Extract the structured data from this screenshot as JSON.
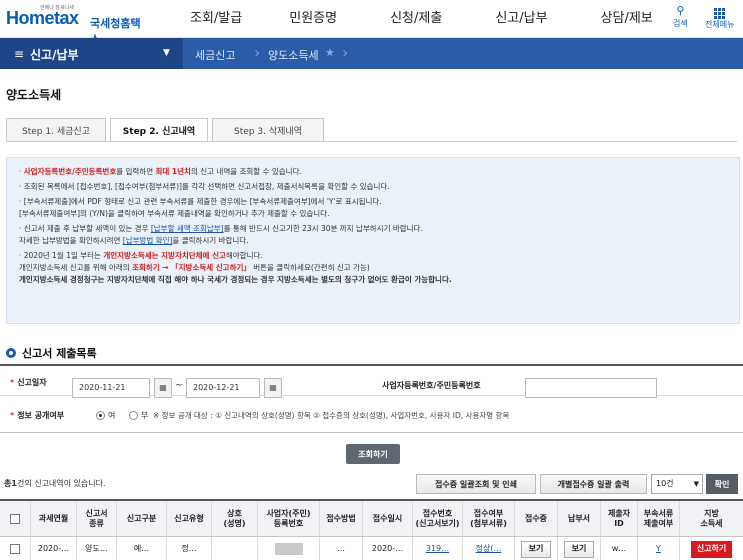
{
  "header": {
    "logo_text": "Hometax",
    "logo_tagline": "언제나 잘세나세",
    "logo_sub": "국세청홈택스",
    "menu": [
      "조회/발급",
      "민원증명",
      "신청/제출",
      "신고/납부",
      "상담/제보"
    ],
    "search_label": "검색",
    "all_menu_label": "전체메뉴"
  },
  "nav": {
    "section": "신고/납부",
    "crumb1": "세금신고",
    "crumb2": "양도소득세"
  },
  "page": {
    "title": "양도소득세"
  },
  "tabs": [
    "Step 1. 세금신고",
    "Step 2. 신고내역",
    "Step 3. 삭제내역"
  ],
  "notice": {
    "l1a": "·",
    "l1b": "사업자등록번호/주민등록번호",
    "l1c": "를 입력하면 ",
    "l1d": "최대 1년치",
    "l1e": "의 신고 내역을 조회할 수 있습니다.",
    "l2": "· 조회된 목록에서 [접수번호], [접수여부(첨부서류)]를 각각 선택하면 신고서접장, 제출서식목록을 확인할 수 있습니다.",
    "l3": "· [부속서류제출]에서 PDF 형태로 신고 관련 부속서류를 제출한 경우에는 [부속서류제출여부]에서 'Y'로 표시됩니다.",
    "l4": "  [부속서류제출여부]의 (Y/N)을 클릭하여 부속서류 제출내역을 확인하거나 추가 제출할 수 있습니다.",
    "l5a": "· 신고서 제출 후 납부할 세액이 있는 경우 ",
    "l5b": "[납부할 세액 조회납부]",
    "l5c": "를 통해 반드시 신고기한 23시 30분 까지 납부하시기 바랍니다.",
    "l6a": "  자세한 납부방법을 확인하시려면 ",
    "l6b": "[납부방법 확인]",
    "l6c": "을 클릭하시기 바랍니다.",
    "l7a": "· 2020년 1월 1일 부터는 ",
    "l7b": "개인지방소득세는 지방자치단체에 신고",
    "l7c": "해야합니다.",
    "l8a": "  개인지방소득세 신고를 위해 아래의 ",
    "l8b": "조회하기 → 「지방소득세 신고하기」",
    "l8c": " 버튼을 클릭하세요(간편히 신고 가능)",
    "l9": "  개인지방소득세 경정청구는 지방자치단체에 직접 해야 하나 국세가 경정되는 경우 지방소득세는 별도의 청구가 없어도 환급이 가능합니다."
  },
  "list_section": {
    "title": "신고서 제출목록"
  },
  "form": {
    "date_label": "신고일자",
    "date_from": "2020-11-21",
    "date_to": "2020-12-21",
    "tilde": "~",
    "cal_icon": "calendar-icon",
    "biz_label": "사업자등록번호/주민등록번호",
    "biz_value": "",
    "disclose_label": "정보 공개여부",
    "radio_yes": "여",
    "radio_no": "부",
    "disclose_note": "※ 정보 공개 대상 : ① 신고내역의 상호(성명) 항목 ② 접수증의 상호(성명), 사업자번호, 사용자 ID, 사용자명 항목",
    "search_button": "조회하기"
  },
  "results": {
    "count_prefix": "총",
    "count": "1",
    "count_suffix": "건의 신고내역이 있습니다.",
    "btn_bulk": "접수증 일괄조회 및 인쇄",
    "btn_individual": "개별접수증 일괄 출력",
    "page_size": "10건",
    "confirm": "확인"
  },
  "table": {
    "headers": [
      "",
      "과세연월",
      "신고서\n종류",
      "신고구분",
      "신고유형",
      "상호\n(성명)",
      "사업자(주민)\n등록번호",
      "접수방법",
      "접수일시",
      "접수번호\n(신고서보기)",
      "접수여부\n(첨부서류)",
      "접수증",
      "납부서",
      "제출자\nID",
      "부속서류\n제출여부",
      "지방\n소득세"
    ],
    "row": {
      "period": "2020-…",
      "form_type": "양도…",
      "category": "예…",
      "report_type": "정…",
      "name": "",
      "id_no": "",
      "method": "…",
      "datetime": "2020-…",
      "receipt_no": "319…",
      "status": "정상(…",
      "receipt_btn": "보기",
      "payment_btn": "보기",
      "submitter": "w…",
      "attach": "Y",
      "local_tax_btn": "신고하기"
    }
  }
}
